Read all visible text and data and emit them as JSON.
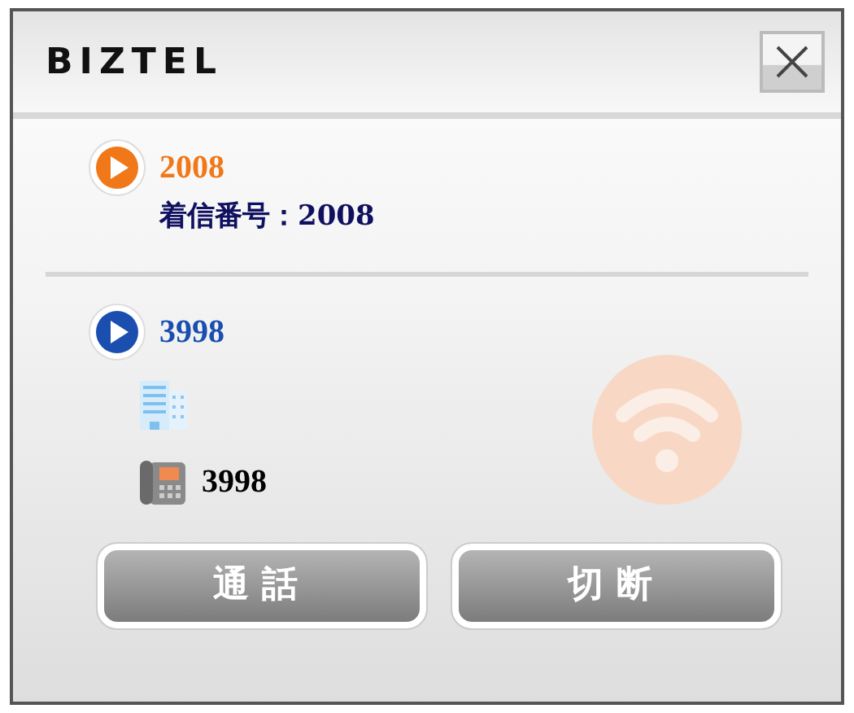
{
  "window": {
    "title": "BIZTEL"
  },
  "calls": [
    {
      "number": "2008",
      "color": "#f07818",
      "lines": [
        {
          "kind": "text",
          "text": "着信番号：2008"
        }
      ]
    },
    {
      "number": "3998",
      "color": "#1a4fb0",
      "lines": [
        {
          "kind": "company"
        },
        {
          "kind": "phone",
          "text": "3998"
        }
      ]
    }
  ],
  "buttons": [
    "通話",
    "切断"
  ]
}
